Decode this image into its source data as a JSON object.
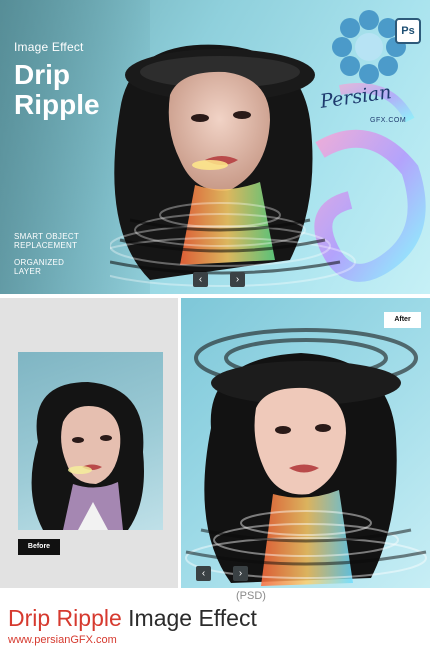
{
  "hero": {
    "eyebrow": "Image Effect",
    "title_line1": "Drip",
    "title_line2": "Ripple",
    "feature1_line1": "SMART OBJECT",
    "feature1_line2": "REPLACEMENT",
    "feature2_line1": "ORGANIZED",
    "feature2_line2": "LAYER",
    "prev_glyph": "‹",
    "next_glyph": "›",
    "ps_badge": "Ps",
    "watermark_script": "Persian",
    "watermark_small": "GFX.COM"
  },
  "compare": {
    "before_label": "Before",
    "after_label": "After",
    "prev_glyph": "‹",
    "next_glyph": "›"
  },
  "footer": {
    "psd_tag": "(PSD)",
    "title_red": "Drip Ripple",
    "title_dark": " Image Effect",
    "site": "www.persianGFX.com"
  },
  "colors": {
    "accent_red": "#d63a2f",
    "hero_teal": "#8fd0dc",
    "dark_label": "#111111"
  },
  "icons": [
    "flower-logo-icon",
    "photoshop-icon",
    "chevron-left-icon",
    "chevron-right-icon"
  ]
}
